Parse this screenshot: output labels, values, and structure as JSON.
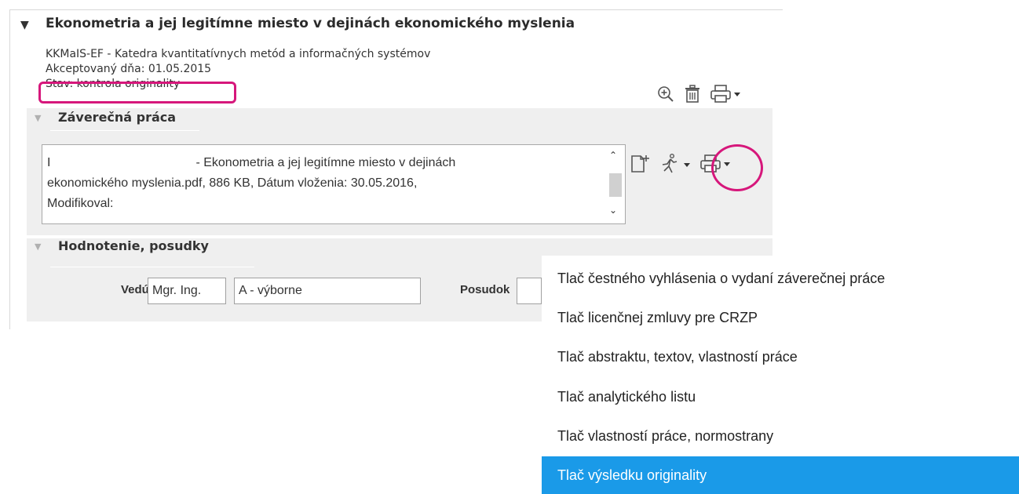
{
  "thesis": {
    "toggle": "▼",
    "title": "Ekonometria a jej legitímne miesto v dejinách ekonomického myslenia",
    "department": "KKMaIS-EF - Katedra kvantitatívnych metód a informačných systémov",
    "accepted": "Akceptovaný dňa: 01.05.2015",
    "status": "Stav: kontrola originality",
    "actions": [
      "zoom-in-icon",
      "trash-icon",
      "printer-icon"
    ]
  },
  "final_work": {
    "toggle": "▼",
    "title": "Záverečná práca",
    "file_line1_a": "I",
    "file_line1_b": "- Ekonometria a jej legitímne miesto v dejinách",
    "file_line2": "ekonomického myslenia.pdf, 886 KB, Dátum vloženia: 30.05.2016,",
    "file_line3": "Modifikoval:",
    "actions": [
      "new-document-icon",
      "run-icon",
      "printer-icon"
    ]
  },
  "review": {
    "toggle": "▼",
    "title": "Hodnotenie, posudky",
    "supervisor_label": "Vedúci",
    "supervisor_title": "Mgr. Ing.",
    "grade": "A - výborne",
    "review_label": "Posudok"
  },
  "print_menu": {
    "items": [
      "Tlač čestného vyhlásenia o vydaní záverečnej práce",
      "Tlač licenčnej zmluvy pre CRZP",
      "Tlač abstraktu, textov, vlastností práce",
      "Tlač analytického listu",
      "Tlač vlastností práce, normostrany",
      "Tlač výsledku originality"
    ],
    "selected_index": 5
  },
  "colors": {
    "highlight": "#d6177b",
    "menu_selected": "#1a9ae8",
    "section_bg": "#efefef"
  }
}
